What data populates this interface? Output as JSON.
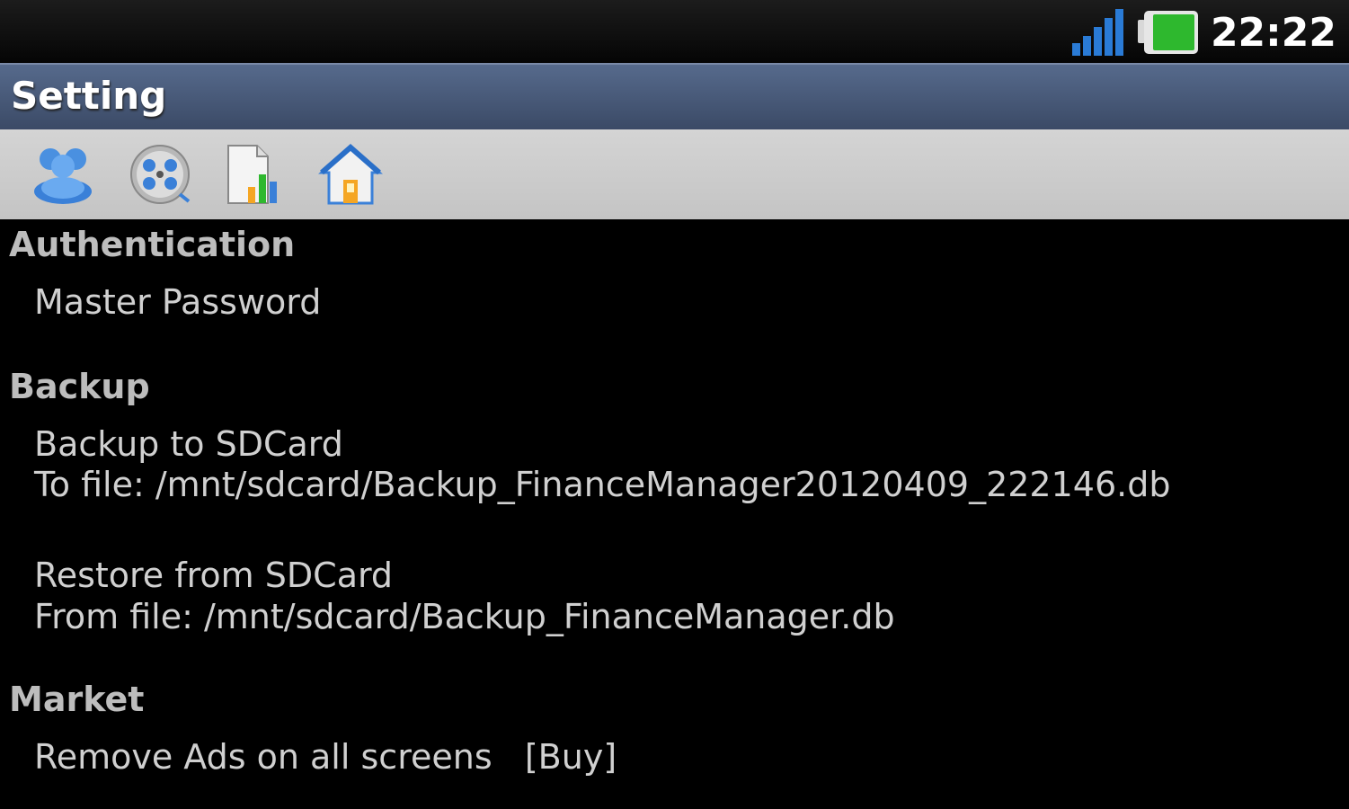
{
  "status_bar": {
    "time": "22:22",
    "icons": [
      "signal-icon",
      "battery-icon"
    ]
  },
  "title_bar": {
    "title": "Setting"
  },
  "toolbar": {
    "buttons": [
      {
        "icon": "users-icon"
      },
      {
        "icon": "film-reel-icon"
      },
      {
        "icon": "report-chart-icon"
      },
      {
        "icon": "home-icon"
      }
    ]
  },
  "sections": {
    "authentication": {
      "header": "Authentication",
      "items": [
        {
          "title": "Master Password"
        }
      ]
    },
    "backup": {
      "header": "Backup",
      "items": [
        {
          "title": "Backup to SDCard",
          "summary": "To file: /mnt/sdcard/Backup_FinanceManager20120409_222146.db"
        },
        {
          "title": "Restore from SDCard",
          "summary": "From file: /mnt/sdcard/Backup_FinanceManager.db"
        }
      ]
    },
    "market": {
      "header": "Market",
      "items": [
        {
          "title": "Remove Ads on all screens   [Buy]"
        }
      ]
    }
  },
  "colors": {
    "title_bar": "#4a5a7a",
    "toolbar": "#cccccc",
    "background": "#000000",
    "section_header": "#bdbdbd",
    "item_text": "#d0d0d0"
  }
}
